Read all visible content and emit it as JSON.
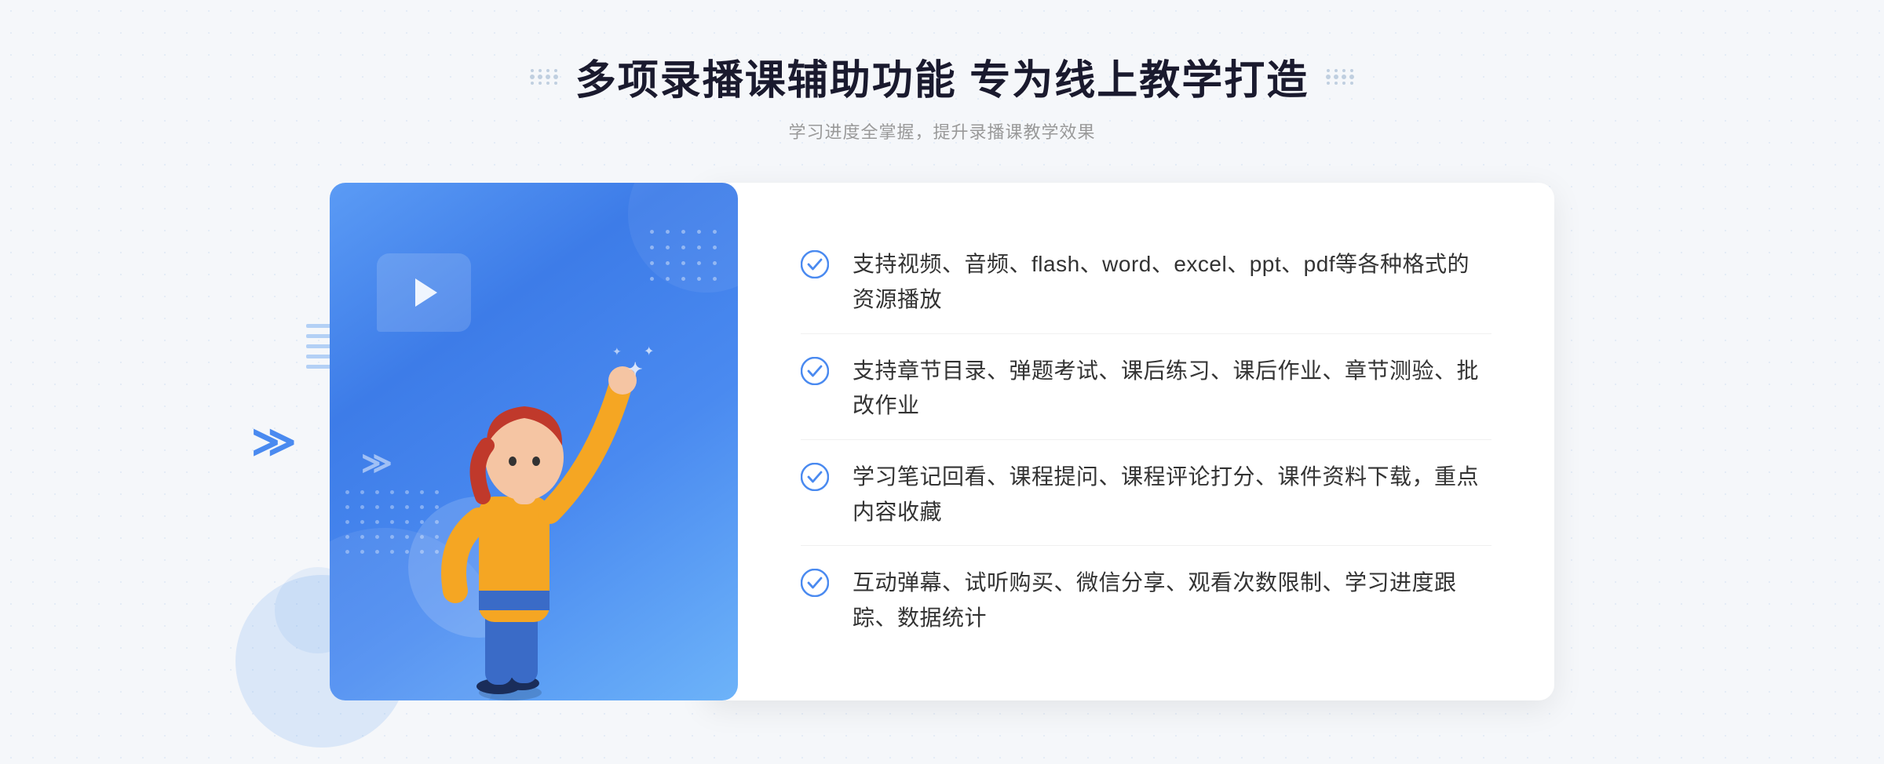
{
  "header": {
    "main_title": "多项录播课辅助功能 专为线上教学打造",
    "subtitle": "学习进度全掌握，提升录播课教学效果"
  },
  "features": [
    {
      "id": 1,
      "text": "支持视频、音频、flash、word、excel、ppt、pdf等各种格式的资源播放"
    },
    {
      "id": 2,
      "text": "支持章节目录、弹题考试、课后练习、课后作业、章节测验、批改作业"
    },
    {
      "id": 3,
      "text": "学习笔记回看、课程提问、课程评论打分、课件资料下载，重点内容收藏"
    },
    {
      "id": 4,
      "text": "互动弹幕、试听购买、微信分享、观看次数限制、学习进度跟踪、数据统计"
    }
  ],
  "colors": {
    "primary_blue": "#4a8af0",
    "light_blue": "#6db3f9",
    "text_dark": "#333333",
    "text_gray": "#999999",
    "white": "#ffffff",
    "check_color": "#4a8af0"
  },
  "icons": {
    "check": "check-circle",
    "play": "play-triangle",
    "chevron": "double-chevron"
  }
}
